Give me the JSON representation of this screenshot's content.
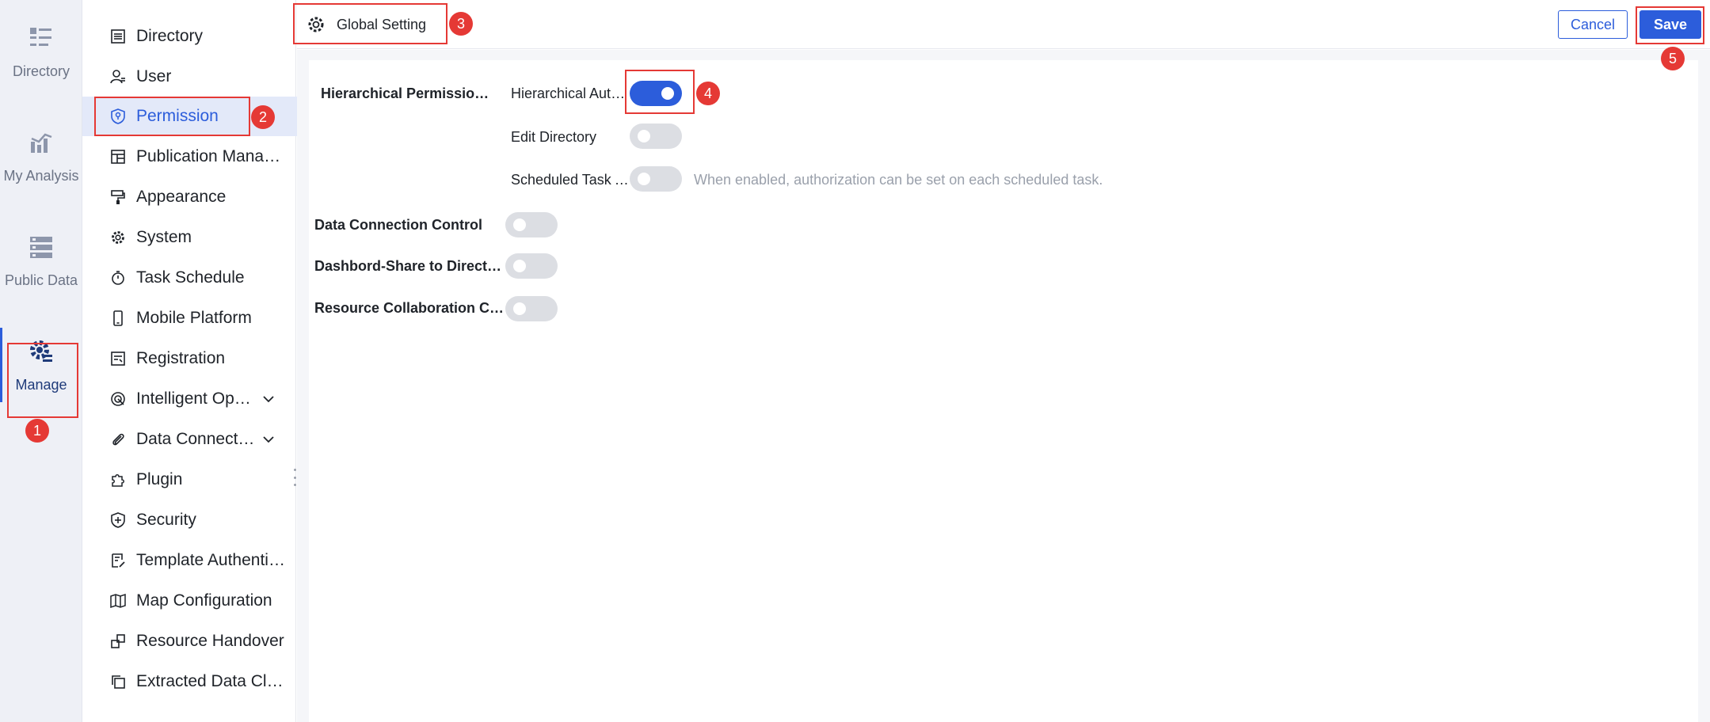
{
  "rail": {
    "items": [
      {
        "label": "Directory",
        "icon": "directory-list-icon"
      },
      {
        "label": "My Analysis",
        "icon": "analysis-chart-icon"
      },
      {
        "label": "Public Data",
        "icon": "database-icon"
      },
      {
        "label": "Manage",
        "icon": "manage-gear-icon"
      }
    ]
  },
  "sidebar": {
    "items": [
      {
        "label": "Directory",
        "icon": "list-icon"
      },
      {
        "label": "User",
        "icon": "user-icon"
      },
      {
        "label": "Permission",
        "icon": "shield-icon"
      },
      {
        "label": "Publication Management",
        "icon": "layout-icon"
      },
      {
        "label": "Appearance",
        "icon": "paint-roller-icon"
      },
      {
        "label": "System",
        "icon": "gear-icon"
      },
      {
        "label": "Task Schedule",
        "icon": "stopwatch-icon"
      },
      {
        "label": "Mobile Platform",
        "icon": "phone-icon"
      },
      {
        "label": "Registration",
        "icon": "registration-icon"
      },
      {
        "label": "Intelligent Operations",
        "icon": "radar-icon"
      },
      {
        "label": "Data Connection",
        "icon": "paperclip-icon"
      },
      {
        "label": "Plugin",
        "icon": "puzzle-icon"
      },
      {
        "label": "Security",
        "icon": "shield-plus-icon"
      },
      {
        "label": "Template Authentication",
        "icon": "template-icon"
      },
      {
        "label": "Map Configuration",
        "icon": "map-icon"
      },
      {
        "label": "Resource Handover",
        "icon": "handover-icon"
      },
      {
        "label": "Extracted Data Cleanup",
        "icon": "copy-icon"
      }
    ]
  },
  "header": {
    "title": "Global Setting",
    "cancel_label": "Cancel",
    "save_label": "Save"
  },
  "settings": {
    "hierarchical_label": "Hierarchical Permission Control",
    "hierarchical_auth_label": "Hierarchical Authorization",
    "hierarchical_auth_on": true,
    "edit_directory_label": "Edit Directory",
    "edit_directory_on": false,
    "scheduled_task_label": "Scheduled Task Authorization",
    "scheduled_task_on": false,
    "scheduled_task_hint": "When enabled, authorization can be set on each scheduled task.",
    "data_connection_label": "Data Connection Control",
    "data_connection_on": false,
    "dashboard_share_label": "Dashbord-Share to Directory",
    "dashboard_share_on": false,
    "resource_collab_label": "Resource Collaboration Control",
    "resource_collab_on": false
  },
  "annotations": [
    "1",
    "2",
    "3",
    "4",
    "5"
  ],
  "colors": {
    "accent": "#2c5ddb",
    "annotation": "#e53935",
    "rail_bg": "#eef0f6"
  }
}
